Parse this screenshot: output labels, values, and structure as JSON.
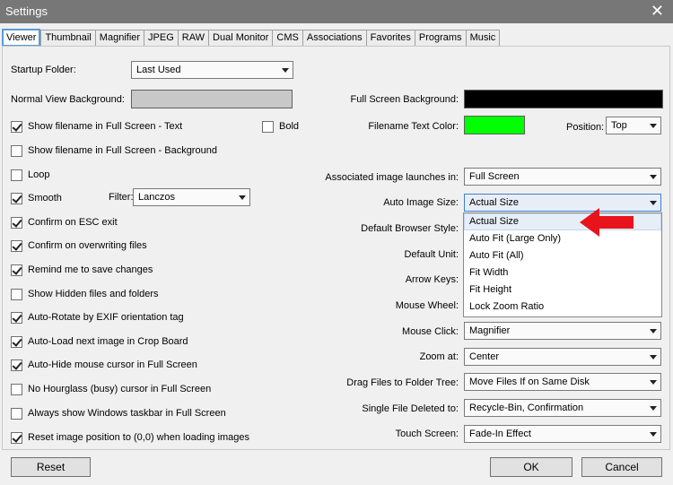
{
  "window": {
    "title": "Settings",
    "close_glyph": "✕"
  },
  "tabs": [
    {
      "label": "Viewer",
      "active": true
    },
    {
      "label": "Thumbnail"
    },
    {
      "label": "Magnifier"
    },
    {
      "label": "JPEG"
    },
    {
      "label": "RAW"
    },
    {
      "label": "Dual Monitor"
    },
    {
      "label": "CMS"
    },
    {
      "label": "Associations"
    },
    {
      "label": "Favorites"
    },
    {
      "label": "Programs"
    },
    {
      "label": "Music"
    }
  ],
  "left": {
    "startup_folder_label": "Startup Folder:",
    "startup_folder_value": "Last Used",
    "normal_bg_label": "Normal View Background:",
    "normal_bg_color": "#c8c8c8",
    "filter_label": "Filter:",
    "filter_value": "Lanczos",
    "bold_label": "Bold",
    "checkboxes": [
      {
        "label": "Show filename in Full Screen - Text",
        "checked": true
      },
      {
        "label": "Show filename in Full Screen - Background",
        "checked": false
      },
      {
        "label": "Loop",
        "checked": false
      },
      {
        "label": "Smooth",
        "checked": true
      },
      {
        "label": "Confirm on ESC exit",
        "checked": true
      },
      {
        "label": "Confirm on overwriting files",
        "checked": true
      },
      {
        "label": "Remind me to save changes",
        "checked": true
      },
      {
        "label": "Show Hidden files and folders",
        "checked": false
      },
      {
        "label": "Auto-Rotate by EXIF orientation tag",
        "checked": true
      },
      {
        "label": "Auto-Load next image in Crop Board",
        "checked": true
      },
      {
        "label": "Auto-Hide mouse cursor in Full Screen",
        "checked": true
      },
      {
        "label": "No Hourglass (busy) cursor in Full Screen",
        "checked": false
      },
      {
        "label": "Always show Windows taskbar in Full Screen",
        "checked": false
      },
      {
        "label": "Reset image position to (0,0) when loading images",
        "checked": true
      }
    ],
    "bold_checked": false
  },
  "right": {
    "full_screen_bg_label": "Full Screen Background:",
    "full_screen_bg_color": "#000000",
    "filename_text_color_label": "Filename Text Color:",
    "filename_text_color": "#00ff00",
    "position_label": "Position:",
    "position_value": "Top",
    "assoc_label": "Associated image launches in:",
    "assoc_value": "Full Screen",
    "auto_size_label": "Auto Image Size:",
    "auto_size_value": "Actual Size",
    "browser_style_label": "Default Browser Style:",
    "default_unit_label": "Default Unit:",
    "arrow_keys_label": "Arrow Keys:",
    "mouse_wheel_label": "Mouse Wheel:",
    "mouse_click_label": "Mouse Click:",
    "mouse_click_value": "Magnifier",
    "zoom_at_label": "Zoom at:",
    "zoom_at_value": "Center",
    "drag_label": "Drag Files to Folder Tree:",
    "drag_value": "Move Files If on Same Disk",
    "single_delete_label": "Single File Deleted to:",
    "single_delete_value": "Recycle-Bin, Confirmation",
    "touch_label": "Touch Screen:",
    "touch_value": "Fade-In Effect"
  },
  "dropdown": {
    "items": [
      "Actual Size",
      "Auto Fit (Large Only)",
      "Auto Fit (All)",
      "Fit Width",
      "Fit Height",
      "Lock Zoom Ratio"
    ],
    "highlighted": 0,
    "annotation_color": "#e8141c"
  },
  "buttons": {
    "reset": "Reset",
    "ok": "OK",
    "cancel": "Cancel"
  }
}
